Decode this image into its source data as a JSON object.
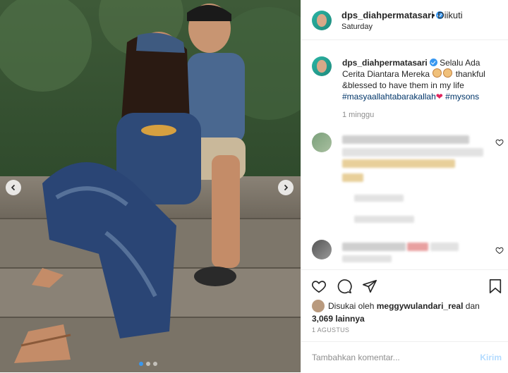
{
  "post": {
    "username": "dps_diahpermatasari",
    "follow_separator": "•",
    "follow_status": "Diikuti",
    "location_subtitle": "Saturday",
    "caption": {
      "username": "dps_diahpermatasari",
      "text_1": "Selalu Ada Cerita Diantara Mereka",
      "text_2": "thankful &blessed to have them in my life",
      "hashtag_1": "#masyaallahtabarakallah",
      "heart": "❤",
      "hashtag_2": "#mysons",
      "time": "1 minggu"
    },
    "likes": {
      "prefix": "Disukai oleh",
      "user": "meggywulandari_real",
      "joiner": "dan",
      "count": "3,069 lainnya"
    },
    "date": "1 AGUSTUS",
    "comment_placeholder": "Tambahkan komentar...",
    "post_button": "Kirim",
    "carousel": {
      "slides": 3,
      "active": 1
    }
  },
  "colors": {
    "accent": "#3897f0",
    "hashtag": "#003569",
    "muted": "#8e8e8e",
    "post_button_disabled": "#b3dbff"
  },
  "icons": [
    "verified-badge-icon",
    "heart-icon",
    "comment-icon",
    "share-icon",
    "bookmark-icon",
    "chevron-left-icon",
    "chevron-right-icon"
  ]
}
